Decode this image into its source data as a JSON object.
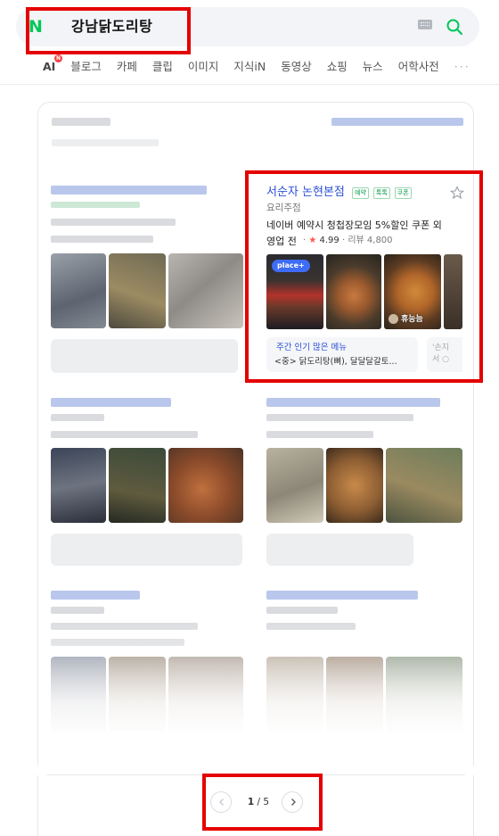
{
  "search": {
    "logo": "N",
    "query": "강남닭도리탕",
    "keyboard_icon": "keyboard-icon",
    "search_icon": "search-icon",
    "accent": "#03c75a"
  },
  "tabs": {
    "ai_label": "AI",
    "ai_badge": "N",
    "items": [
      "블로그",
      "카페",
      "클립",
      "이미지",
      "지식iN",
      "동영상",
      "쇼핑",
      "뉴스",
      "어학사전"
    ],
    "more": "···"
  },
  "featured": {
    "name": "서순자 논현본점",
    "badges": [
      "예약",
      "톡톡",
      "쿠폰"
    ],
    "category": "요리주점",
    "desc_line1": "네이버 예약시 청첩장모임 5%할인 쿠폰 외",
    "desc_line2": "영업 전",
    "rating_star": "★",
    "rating_value": "4.99",
    "reviews_label": "리뷰 4,800",
    "place_badge": "place+",
    "photo_owner": "휴능늠",
    "menu_title": "주간 인기 많은 메뉴",
    "menu_item": "<중> 닭도리탕(뼈), 달달달갈토...",
    "menu_peek_1": "'손지",
    "menu_peek_2": "서 ○"
  },
  "pager": {
    "current": "1",
    "separator": "/",
    "total": "5"
  },
  "colors": {
    "link_blue": "#2a4fd6",
    "highlight_red": "#e50000",
    "star_red": "#ff5a4e"
  }
}
